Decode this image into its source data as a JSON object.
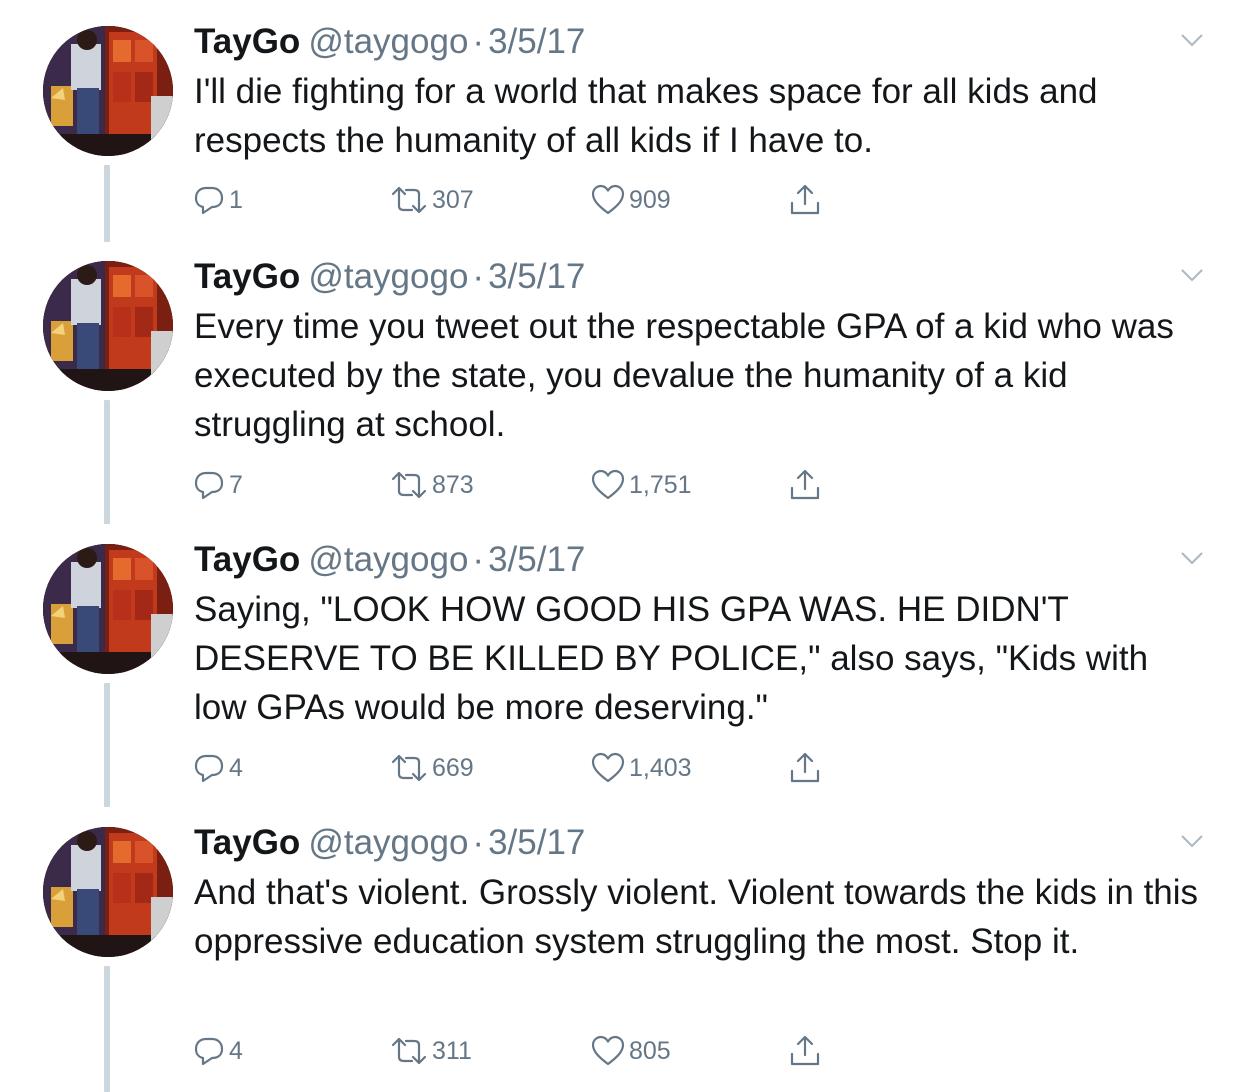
{
  "tweets": [
    {
      "name": "TayGo",
      "handle": "@taygogo",
      "separator": "·",
      "date": "3/5/17",
      "text": "I'll die fighting for a world that makes space for all kids and respects the humanity of all kids if I have to.",
      "replies": "1",
      "retweets": "307",
      "likes": "909"
    },
    {
      "name": "TayGo",
      "handle": "@taygogo",
      "separator": "·",
      "date": "3/5/17",
      "text": "Every time you tweet out the respectable GPA of a kid who was executed by the state, you devalue the humanity of a kid struggling at school.",
      "replies": "7",
      "retweets": "873",
      "likes": "1,751"
    },
    {
      "name": "TayGo",
      "handle": "@taygogo",
      "separator": "·",
      "date": "3/5/17",
      "text": "Saying, \"LOOK HOW GOOD HIS GPA WAS. HE DIDN'T DESERVE TO BE KILLED BY POLICE,\" also says, \"Kids with low GPAs would be more deserving.\"",
      "replies": "4",
      "retweets": "669",
      "likes": "1,403"
    },
    {
      "name": "TayGo",
      "handle": "@taygogo",
      "separator": "·",
      "date": "3/5/17",
      "text": "And that's violent. Grossly violent. Violent towards the kids in this oppressive education system struggling the most. Stop it.",
      "replies": "4",
      "retweets": "311",
      "likes": "805"
    }
  ],
  "icons": {
    "reply": "reply-icon",
    "retweet": "retweet-icon",
    "like": "heart-icon",
    "share": "share-icon",
    "caret": "chevron-down-icon"
  },
  "colors": {
    "text": "#14171a",
    "secondary": "#657786",
    "thread_line": "#ccd6dd"
  }
}
